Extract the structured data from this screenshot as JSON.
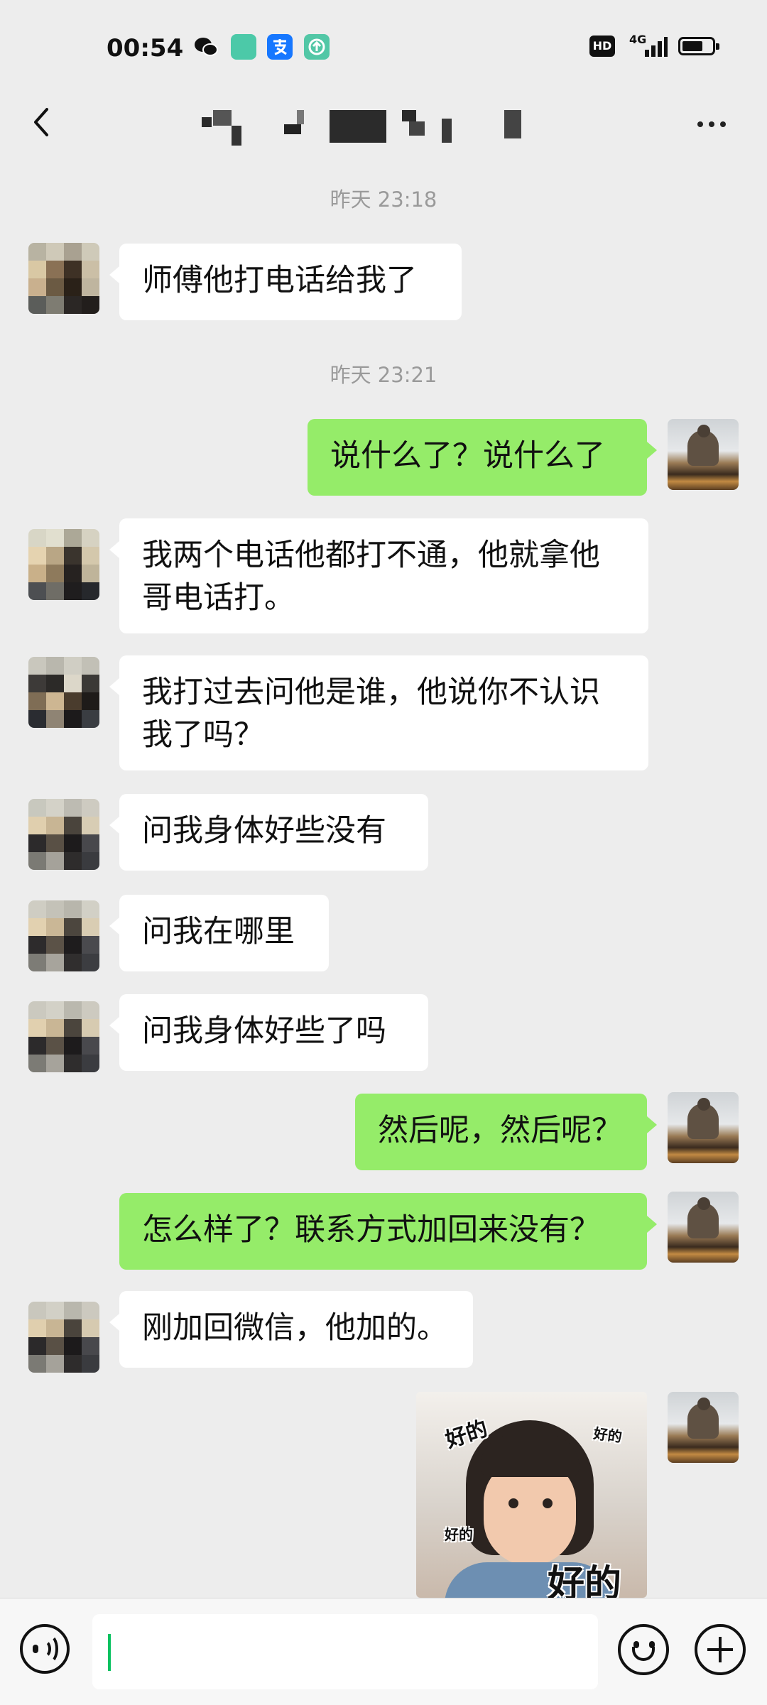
{
  "status_bar": {
    "time": "00:54",
    "icons": [
      "wechat-icon",
      "app-icon-green",
      "alipay-icon",
      "upload-app-icon"
    ],
    "hd_label": "HD",
    "network_label": "4G",
    "battery_level": 0.7
  },
  "header": {
    "back_icon": "chevron-left-icon",
    "title_blurred": true,
    "more_icon": "more-dots-icon"
  },
  "messages": [
    {
      "type": "time",
      "text": "昨天 23:18"
    },
    {
      "type": "text",
      "side": "left",
      "text": "师傅他打电话给我了"
    },
    {
      "type": "time",
      "text": "昨天 23:21"
    },
    {
      "type": "text",
      "side": "right",
      "text": "说什么了？说什么了"
    },
    {
      "type": "text",
      "side": "left",
      "text": "我两个电话他都打不通，他就拿他哥电话打。"
    },
    {
      "type": "text",
      "side": "left",
      "text": "我打过去问他是谁，他说你不认识我了吗？"
    },
    {
      "type": "text",
      "side": "left",
      "text": "问我身体好些没有"
    },
    {
      "type": "text",
      "side": "left",
      "text": "问我在哪里"
    },
    {
      "type": "text",
      "side": "left",
      "text": "问我身体好些了吗"
    },
    {
      "type": "text",
      "side": "right",
      "text": "然后呢，然后呢？"
    },
    {
      "type": "text",
      "side": "right",
      "text": "怎么样了？联系方式加回来没有？"
    },
    {
      "type": "text",
      "side": "left",
      "text": "刚加回微信，他加的。"
    },
    {
      "type": "sticker",
      "side": "right",
      "captions": [
        "好的",
        "好的",
        "好的",
        "好的"
      ]
    }
  ],
  "input_bar": {
    "voice_icon": "voice-icon",
    "emoji_icon": "emoji-icon",
    "plus_icon": "plus-icon",
    "text_value": ""
  },
  "colors": {
    "background": "#ededed",
    "bubble_self": "#95ec69",
    "bubble_other": "#ffffff",
    "accent": "#07c160"
  }
}
